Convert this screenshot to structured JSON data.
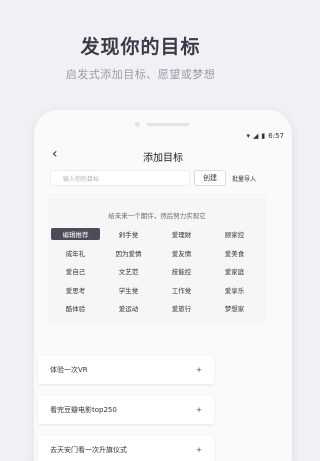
{
  "hero": {
    "title": "发现你的目标",
    "subtitle": "启发式添加目标、愿望或梦想"
  },
  "status_bar": {
    "wifi_icon": "▾",
    "signal_icon": "◢",
    "battery_icon": "▮",
    "time": "6:57"
  },
  "header": {
    "back_icon": "‹",
    "title": "添加目标"
  },
  "input": {
    "placeholder": "输入你的目标",
    "create_label": "创建",
    "import_label": "批量导入"
  },
  "suggestions": {
    "hint": "给未来一个期许，然后努力实现它",
    "tags": [
      {
        "label": "编辑推荐",
        "active": true
      },
      {
        "label": "剁手党",
        "active": false
      },
      {
        "label": "爱理财",
        "active": false
      },
      {
        "label": "顾家控",
        "active": false
      },
      {
        "label": "成年礼",
        "active": false
      },
      {
        "label": "因为爱情",
        "active": false
      },
      {
        "label": "爱友情",
        "active": false
      },
      {
        "label": "爱美食",
        "active": false
      },
      {
        "label": "爱自己",
        "active": false
      },
      {
        "label": "文艺范",
        "active": false
      },
      {
        "label": "技能控",
        "active": false
      },
      {
        "label": "爱家庭",
        "active": false
      },
      {
        "label": "爱思考",
        "active": false
      },
      {
        "label": "学生党",
        "active": false
      },
      {
        "label": "工作党",
        "active": false
      },
      {
        "label": "爱享乐",
        "active": false
      },
      {
        "label": "酷体验",
        "active": false
      },
      {
        "label": "爱运动",
        "active": false
      },
      {
        "label": "爱旅行",
        "active": false
      },
      {
        "label": "梦想家",
        "active": false
      }
    ]
  },
  "goals": [
    {
      "label": "体验一次VR",
      "plus": "+"
    },
    {
      "label": "看完豆瓣电影top250",
      "plus": "+"
    },
    {
      "label": "去天安门看一次升旗仪式",
      "plus": "+"
    }
  ]
}
